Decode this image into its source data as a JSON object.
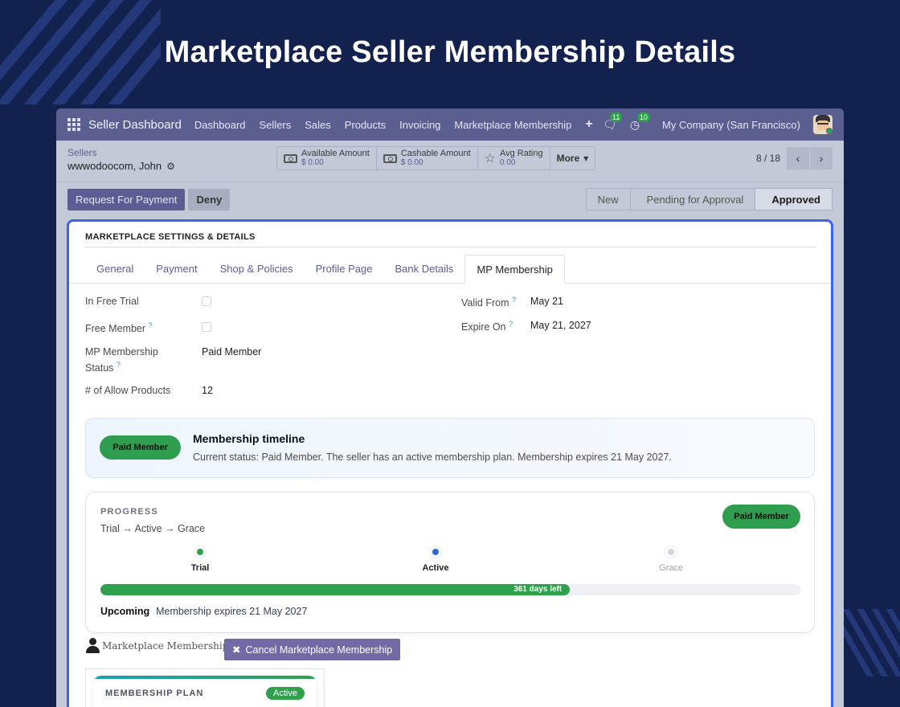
{
  "page": {
    "title": "Marketplace Seller Membership Details"
  },
  "navbar": {
    "brand": "Seller Dashboard",
    "menu": [
      "Dashboard",
      "Sellers",
      "Sales",
      "Products",
      "Invoicing",
      "Marketplace Membership"
    ],
    "plus": "+",
    "messages_count": "11",
    "activities_count": "10",
    "company": "My Company (San Francisco)"
  },
  "control_panel": {
    "breadcrumb_parent": "Sellers",
    "breadcrumb_current": "wwwodoocom, John",
    "stats": [
      {
        "label": "Available Amount",
        "value": "$ 0.00"
      },
      {
        "label": "Cashable Amount",
        "value": "$ 0.00"
      },
      {
        "label": "Avg Rating",
        "value": "0.00"
      }
    ],
    "more_label": "More",
    "pager": "8 / 18"
  },
  "actions": {
    "request_payment": "Request For Payment",
    "deny": "Deny",
    "statuses": [
      "New",
      "Pending for Approval",
      "Approved"
    ],
    "active_status": "Approved"
  },
  "sheet": {
    "section_title": "MARKETPLACE SETTINGS & DETAILS",
    "tabs": [
      "General",
      "Payment",
      "Shop & Policies",
      "Profile Page",
      "Bank Details",
      "MP Membership"
    ],
    "active_tab": "MP Membership",
    "fields": {
      "in_free_trial": {
        "label": "In Free Trial",
        "checked": false
      },
      "free_member": {
        "label": "Free Member",
        "checked": false
      },
      "mp_status": {
        "label_line1": "MP Membership",
        "label_line2": "Status",
        "value": "Paid Member"
      },
      "allow_products": {
        "label": "# of Allow Products",
        "value": "12"
      },
      "valid_from": {
        "label": "Valid From",
        "value": "May 21"
      },
      "expire_on": {
        "label": "Expire On",
        "value": "May 21, 2027"
      }
    },
    "help_mark": "?"
  },
  "timeline": {
    "badge": "Paid Member",
    "title": "Membership timeline",
    "description": "Current status: Paid Member. The seller has an active membership plan. Membership expires 21 May 2027."
  },
  "progress": {
    "label": "PROGRESS",
    "flow": "Trial → Active → Grace",
    "badge": "Paid Member",
    "steps": [
      {
        "name": "Trial",
        "color": "#2fa14c"
      },
      {
        "name": "Active",
        "color": "#2f66d8"
      },
      {
        "name": "Grace",
        "color": "#cfd6e0"
      }
    ],
    "fill_percent": 67,
    "bar_text": "361 days left",
    "upcoming_label": "Upcoming",
    "upcoming_text": "Membership expires 21 May 2027"
  },
  "plan": {
    "section_label": "Marketplace Membership Plan",
    "cancel_label": "Cancel Marketplace Membership",
    "card_title": "MEMBERSHIP PLAN",
    "card_badge": "Active"
  },
  "colors": {
    "accent": "#3c64e6",
    "success": "#2fa14c",
    "navbar": "#5a5f8f",
    "background": "#13214f"
  }
}
